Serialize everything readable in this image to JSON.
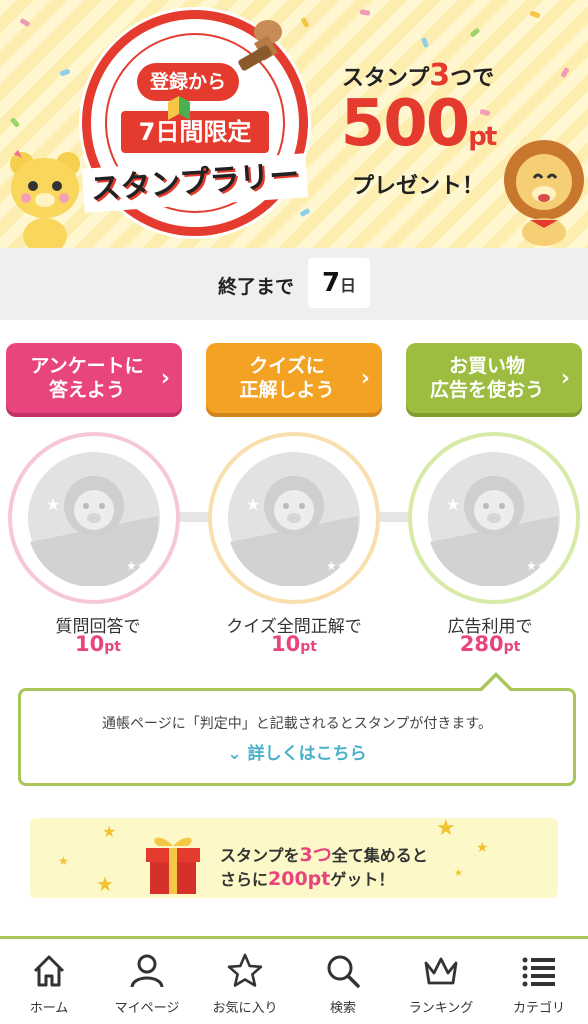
{
  "hero": {
    "badge": "登録から",
    "days_limited": "7日間限定",
    "rally": "スタンプラリー",
    "offer_prefix": "スタンプ",
    "offer_count": "3",
    "offer_suffix": "つで",
    "offer_points": "500",
    "offer_unit": "pt",
    "offer_present": "プレゼント！"
  },
  "countdown": {
    "label": "終了まで",
    "value": "7",
    "unit": "日"
  },
  "actions": [
    {
      "line1": "アンケートに",
      "line2": "答えよう"
    },
    {
      "line1": "クイズに",
      "line2": "正解しよう"
    },
    {
      "line1": "お買い物",
      "line2": "広告を使おう"
    }
  ],
  "stamps": [
    {
      "label": "質問回答で",
      "points": "10",
      "unit": "pt"
    },
    {
      "label": "クイズ全問正解で",
      "points": "10",
      "unit": "pt"
    },
    {
      "label": "広告利用で",
      "points": "280",
      "unit": "pt"
    }
  ],
  "info": {
    "text": "通帳ページに「判定中」と記載されるとスタンプが付きます。",
    "link": "詳しくはこちら"
  },
  "bonus": {
    "l1_prefix": "スタンプを",
    "l1_count": "3つ",
    "l1_suffix": "全て集めると",
    "l2_prefix": "さらに",
    "l2_points": "200pt",
    "l2_suffix": "ゲット！"
  },
  "nav": [
    {
      "label": "ホーム",
      "icon": "home-icon"
    },
    {
      "label": "マイページ",
      "icon": "person-icon"
    },
    {
      "label": "お気に入り",
      "icon": "star-icon"
    },
    {
      "label": "検索",
      "icon": "search-icon"
    },
    {
      "label": "ランキング",
      "icon": "crown-icon"
    },
    {
      "label": "カテゴリ",
      "icon": "list-icon"
    }
  ],
  "colors": {
    "pink": "#e8457f",
    "orange": "#f4a224",
    "green": "#9cbd3f",
    "red": "#e53b2e",
    "link": "#4ab2c8"
  }
}
